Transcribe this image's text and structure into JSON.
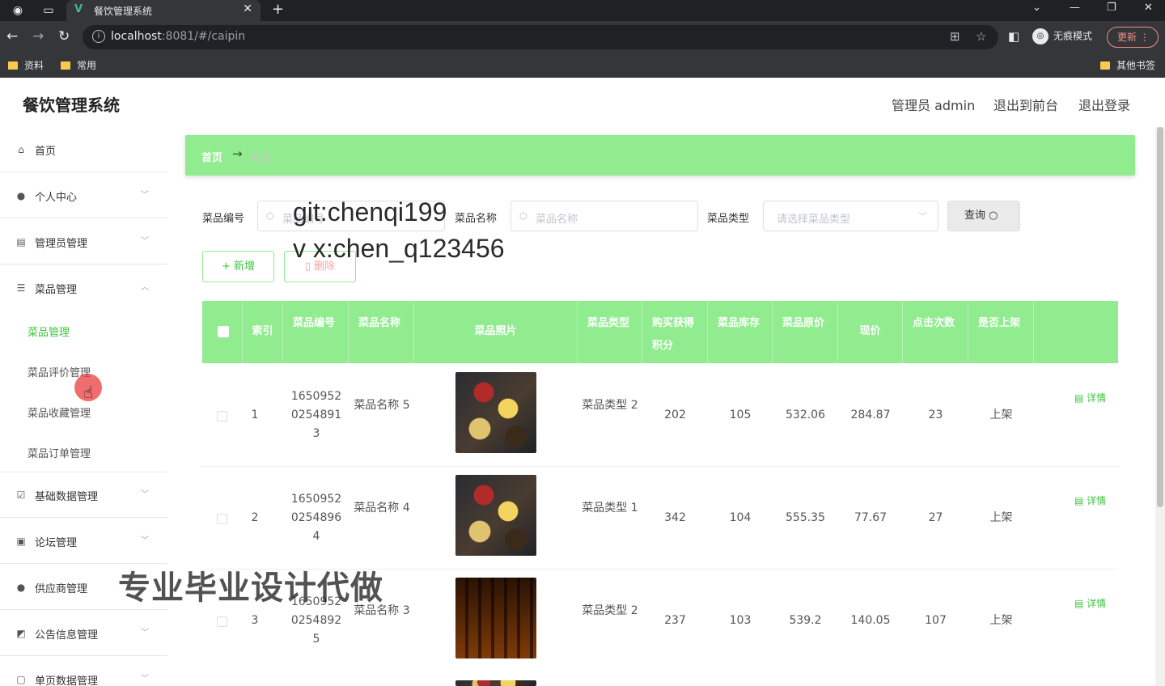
{
  "browser": {
    "tab_title": "餐饮管理系统",
    "url_host": "localhost",
    "url_rest": ":8081/#/caipin",
    "incognito_label": "无痕模式",
    "update_label": "更新",
    "bookmarks": [
      "资料",
      "常用"
    ],
    "other_bookmarks": "其他书签"
  },
  "app": {
    "title": "餐饮管理系统",
    "user_label": "管理员 admin",
    "back_front_label": "退出到前台",
    "logout_label": "退出登录"
  },
  "sidebar": {
    "items": [
      {
        "label": "首页",
        "icon": "home-icon"
      },
      {
        "label": "个人中心",
        "icon": "user-icon"
      },
      {
        "label": "管理员管理",
        "icon": "document-icon"
      },
      {
        "label": "菜品管理",
        "icon": "sliders-icon"
      },
      {
        "label": "基础数据管理",
        "icon": "checklist-icon"
      },
      {
        "label": "论坛管理",
        "icon": "briefcase-icon"
      },
      {
        "label": "供应商管理",
        "icon": "user-icon"
      },
      {
        "label": "公告信息管理",
        "icon": "chart-icon"
      },
      {
        "label": "单页数据管理",
        "icon": "page-icon"
      }
    ],
    "sub_items": [
      "菜品管理",
      "菜品评价管理",
      "菜品收藏管理",
      "菜品订单管理"
    ]
  },
  "breadcrumb": {
    "home": "首页",
    "separator": "→",
    "current": "菜品"
  },
  "search": {
    "code_label": "菜品编号",
    "code_placeholder": "菜品编号",
    "name_label": "菜品名称",
    "name_placeholder": "菜品名称",
    "type_label": "菜品类型",
    "type_placeholder": "请选择菜品类型",
    "query_label": "查询"
  },
  "actions": {
    "add_label": "+ 新增",
    "delete_label": "删除"
  },
  "watermarks": {
    "git": "git:chenqi199",
    "wx": "v x:chen_q123456",
    "promo": "专业毕业设计代做"
  },
  "table": {
    "headers": [
      "索引",
      "菜品编号",
      "菜品名称",
      "菜品照片",
      "菜品类型",
      "购买获得积分",
      "菜品库存",
      "菜品原价",
      "现价",
      "点击次数",
      "是否上架"
    ],
    "detail_label": "详情",
    "rows": [
      {
        "index": "1",
        "code": "1650952 0254891 3",
        "name": "菜品名称 5",
        "type": "菜品类型 2",
        "points": "202",
        "stock": "105",
        "orig_price": "532.06",
        "price": "284.87",
        "clicks": "23",
        "status": "上架"
      },
      {
        "index": "2",
        "code": "1650952 0254896 4",
        "name": "菜品名称 4",
        "type": "菜品类型 1",
        "points": "342",
        "stock": "104",
        "orig_price": "555.35",
        "price": "77.67",
        "clicks": "27",
        "status": "上架"
      },
      {
        "index": "3",
        "code": "1650952 0254892 5",
        "name": "菜品名称 3",
        "type": "菜品类型 2",
        "points": "237",
        "stock": "103",
        "orig_price": "539.2",
        "price": "140.05",
        "clicks": "107",
        "status": "上架"
      }
    ]
  },
  "colors": {
    "accent": "#90ec8e",
    "accent_text": "#3ec53e",
    "chrome_dark": "#202124",
    "chrome": "#35363a"
  }
}
